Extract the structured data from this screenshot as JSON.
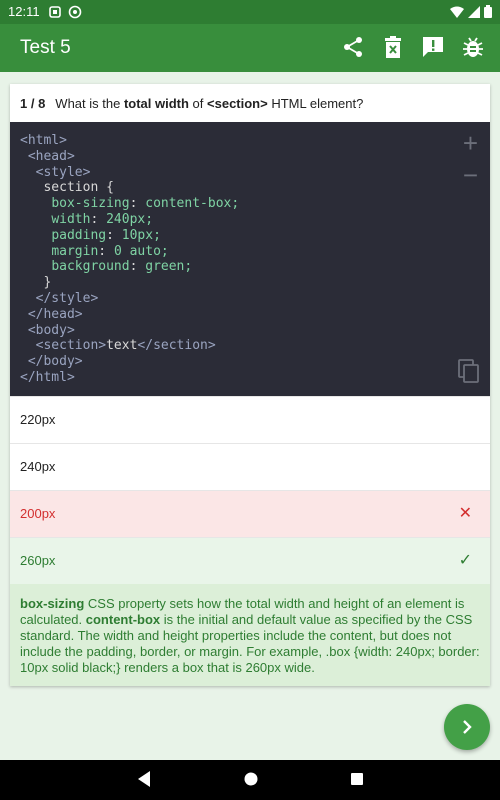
{
  "status": {
    "time": "12:11"
  },
  "appbar": {
    "title": "Test 5"
  },
  "question": {
    "counter": "1 / 8",
    "text_pre": "What is the ",
    "text_bold1": "total width",
    "text_mid": " of ",
    "text_bold2": "<section>",
    "text_post": " HTML element?"
  },
  "code": {
    "lines": {
      "l1": "<html>",
      "l2": "<head>",
      "l3": "<style>",
      "l4": "section {",
      "l5_prop": "box-sizing",
      "l5_val": "content-box;",
      "l6_prop": "width",
      "l6_val": "240px;",
      "l7_prop": "padding",
      "l7_val": "10px;",
      "l8_prop": "margin",
      "l8_val": "0 auto;",
      "l9_prop": "background",
      "l9_val": "green;",
      "l10": "}",
      "l11": "</style>",
      "l12": "</head>",
      "l13": "<body>",
      "l14_open": "<section>",
      "l14_text": "text",
      "l14_close": "</section>",
      "l15": "</body>",
      "l16": "</html>"
    }
  },
  "options": [
    {
      "label": "220px",
      "state": "neutral"
    },
    {
      "label": "240px",
      "state": "neutral"
    },
    {
      "label": "200px",
      "state": "wrong",
      "mark": "✕"
    },
    {
      "label": "260px",
      "state": "correct",
      "mark": "✓"
    }
  ],
  "explanation": {
    "b1": "box-sizing",
    "t1": " CSS property sets how the total width and height of an element is calculated. ",
    "b2": "content-box",
    "t2": " is the initial and default value as specified by the CSS standard. The width and height properties include the content, but does not include the padding, border, or margin. For example, .box {width: 240px; border: 10px solid black;} renders a box that is 260px wide."
  },
  "colors": {
    "appbar": "#388e3c",
    "statusbar": "#2e7d32",
    "wrong": "#d32f2f",
    "correct": "#2e7d32",
    "code_bg": "#2b2c37"
  }
}
